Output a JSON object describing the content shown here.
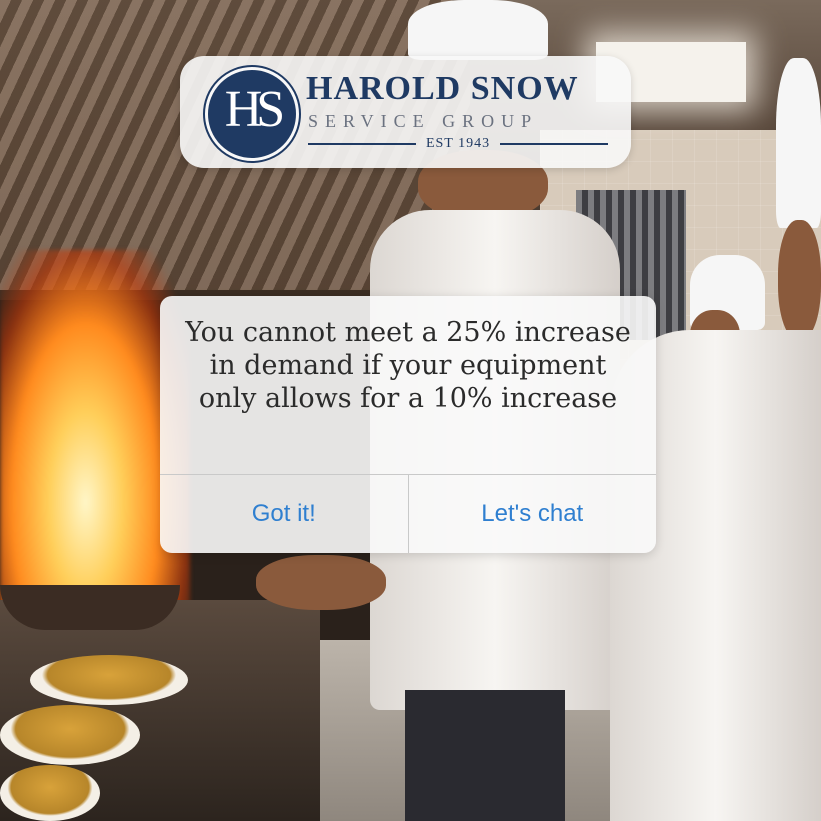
{
  "logo": {
    "monogram": "HS",
    "name": "HAROLD SNOW",
    "subtitle": "SERVICE GROUP",
    "established": "EST 1943",
    "brand_color": "#1f3a63"
  },
  "dialog": {
    "message": "You cannot meet a 25% increase in demand if your equipment only allows for a 10% increase",
    "buttons": {
      "dismiss_label": "Got it!",
      "chat_label": "Let's chat"
    },
    "button_color": "#2f7fd0"
  }
}
